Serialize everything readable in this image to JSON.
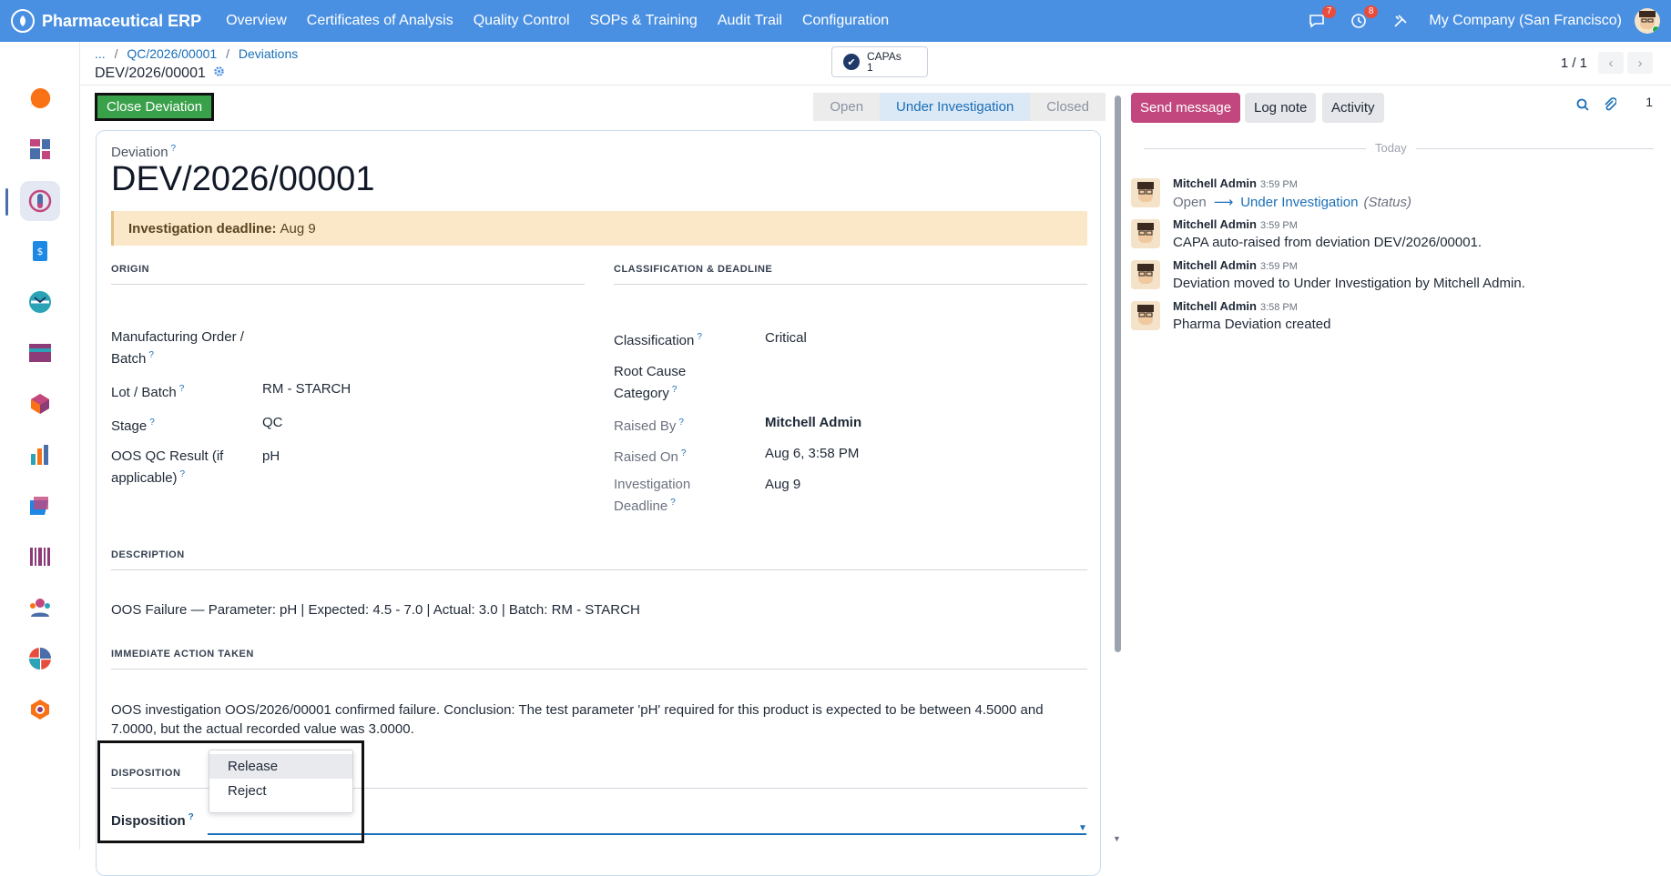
{
  "topbar": {
    "brand": "Pharmaceutical ERP",
    "menu": [
      "Overview",
      "Certificates of Analysis",
      "Quality Control",
      "SOPs & Training",
      "Audit Trail",
      "Configuration"
    ],
    "messages_badge": "7",
    "activities_badge": "8",
    "company": "My Company (San Francisco)"
  },
  "breadcrumb": {
    "ellipsis": "...",
    "item1": "QC/2026/00001",
    "item2": "Deviations",
    "current": "DEV/2026/00001"
  },
  "smart_button": {
    "label": "CAPAs",
    "count": "1"
  },
  "pager": {
    "text": "1 / 1"
  },
  "actions": {
    "close_deviation": "Close Deviation"
  },
  "statusbar": {
    "stages": [
      "Open",
      "Under Investigation",
      "Closed"
    ],
    "active": "Under Investigation"
  },
  "form": {
    "model_label": "Deviation",
    "title": "DEV/2026/00001",
    "alert_label": "Investigation deadline:",
    "alert_value": "Aug 9",
    "origin": {
      "section": "ORIGIN",
      "mo_label": "Manufacturing Order / Batch",
      "mo_value": "",
      "lot_label": "Lot / Batch",
      "lot_value": "RM - STARCH",
      "stage_label": "Stage",
      "stage_value": "QC",
      "oos_label": "OOS QC Result (if applicable)",
      "oos_value": "pH"
    },
    "classification": {
      "section": "CLASSIFICATION & DEADLINE",
      "class_label": "Classification",
      "class_value": "Critical",
      "root_label": "Root Cause Category",
      "root_value": "",
      "raised_by_label": "Raised By",
      "raised_by_value": "Mitchell Admin",
      "raised_on_label": "Raised On",
      "raised_on_value": "Aug 6, 3:58 PM",
      "deadline_label": "Investigation Deadline",
      "deadline_value": "Aug 9"
    },
    "description": {
      "section": "DESCRIPTION",
      "text": "OOS Failure — Parameter: pH | Expected: 4.5 - 7.0 | Actual: 3.0 | Batch: RM - STARCH"
    },
    "immediate_action": {
      "section": "IMMEDIATE ACTION TAKEN",
      "text": "OOS investigation OOS/2026/00001 confirmed failure. Conclusion: The test parameter 'pH' required for this product is expected to be between 4.5000 and 7.0000, but the actual recorded value was 3.0000."
    },
    "disposition": {
      "section": "DISPOSITION",
      "label": "Disposition",
      "options": [
        "Release",
        "Reject"
      ],
      "highlighted": "Release"
    }
  },
  "chatter": {
    "send_message": "Send message",
    "log_note": "Log note",
    "activity": "Activity",
    "followers_count": "1",
    "today": "Today",
    "messages": [
      {
        "author": "Mitchell Admin",
        "time": "3:59 PM",
        "from": "Open",
        "to": "Under Investigation",
        "note": "(Status)"
      },
      {
        "author": "Mitchell Admin",
        "time": "3:59 PM",
        "text": "CAPA auto-raised from deviation DEV/2026/00001."
      },
      {
        "author": "Mitchell Admin",
        "time": "3:59 PM",
        "text": "Deviation moved to Under Investigation by Mitchell Admin."
      },
      {
        "author": "Mitchell Admin",
        "time": "3:58 PM",
        "text": "Pharma Deviation created"
      }
    ]
  },
  "colors": {
    "topbar": "#4a90e2",
    "primary_action": "#3aa14b",
    "send_message": "#c2477e",
    "active_stage": "#dbe8f6",
    "alert_bg": "#fbe8c8"
  }
}
